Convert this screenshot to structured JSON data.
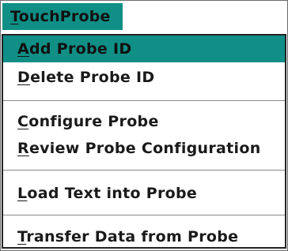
{
  "menubar": {
    "title_mnemonic": "T",
    "title_rest": "ouchProbe"
  },
  "menu": {
    "items": [
      {
        "mnemonic": "A",
        "rest": "dd Probe ID",
        "selected": true
      },
      {
        "mnemonic": "D",
        "rest": "elete Probe ID",
        "selected": false
      },
      {
        "mnemonic": "C",
        "rest": "onfigure Probe",
        "selected": false
      },
      {
        "mnemonic": "R",
        "rest": "eview Probe Configuration",
        "selected": false
      },
      {
        "mnemonic": "L",
        "rest": "oad Text into Probe",
        "selected": false
      },
      {
        "mnemonic": "T",
        "rest": "ransfer Data from Probe",
        "selected": false
      }
    ]
  },
  "colors": {
    "highlight": "#0f8f86",
    "text": "#1a1a1a",
    "background": "#ffffff"
  }
}
